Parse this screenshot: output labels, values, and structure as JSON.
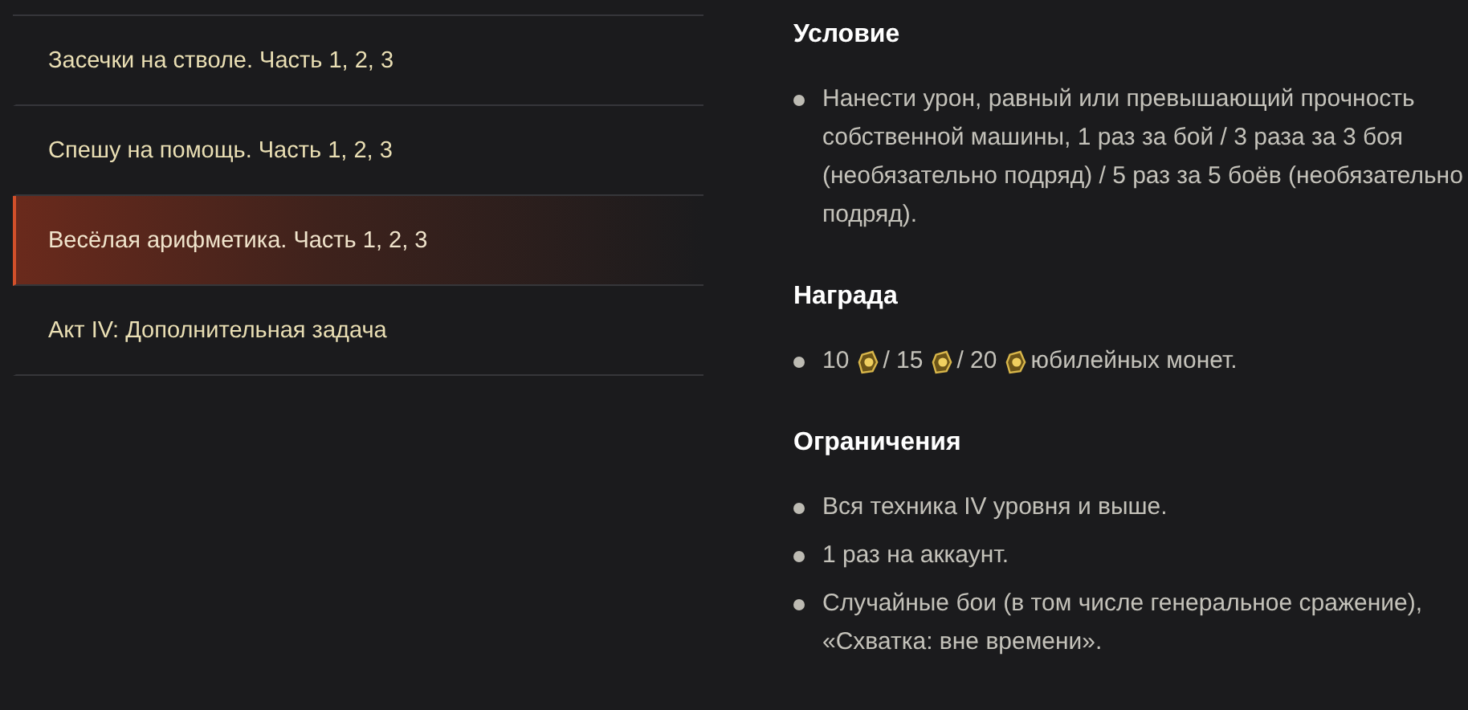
{
  "menu": [
    {
      "label": "Засечки на стволе. Часть 1, 2, 3",
      "selected": false
    },
    {
      "label": "Спешу на помощь. Часть 1, 2, 3",
      "selected": false
    },
    {
      "label": "Весёлая арифметика. Часть 1, 2, 3",
      "selected": true
    },
    {
      "label": "Акт IV: Дополнительная задача",
      "selected": false
    }
  ],
  "sections": [
    {
      "title": "Условие",
      "items": [
        {
          "kind": "text",
          "text": "Нанести урон, равный или превышающий прочность собственной машины, 1 раз за бой / 3 раза за 3 боя (необязательно подряд) / 5 раз за 5 боёв (необязательно подряд)."
        }
      ]
    },
    {
      "title": "Награда",
      "items": [
        {
          "kind": "coins",
          "segments": [
            "10",
            "/ 15",
            "/ 20",
            "юбилейных монет."
          ]
        }
      ]
    },
    {
      "title": "Ограничения",
      "items": [
        {
          "kind": "text",
          "text": "Вся техника IV уровня и выше."
        },
        {
          "kind": "text",
          "text": "1 раз на аккаунт."
        },
        {
          "kind": "text",
          "text": "Случайные бои (в том числе генеральное сражение), «Схватка: вне времени»."
        }
      ]
    }
  ]
}
